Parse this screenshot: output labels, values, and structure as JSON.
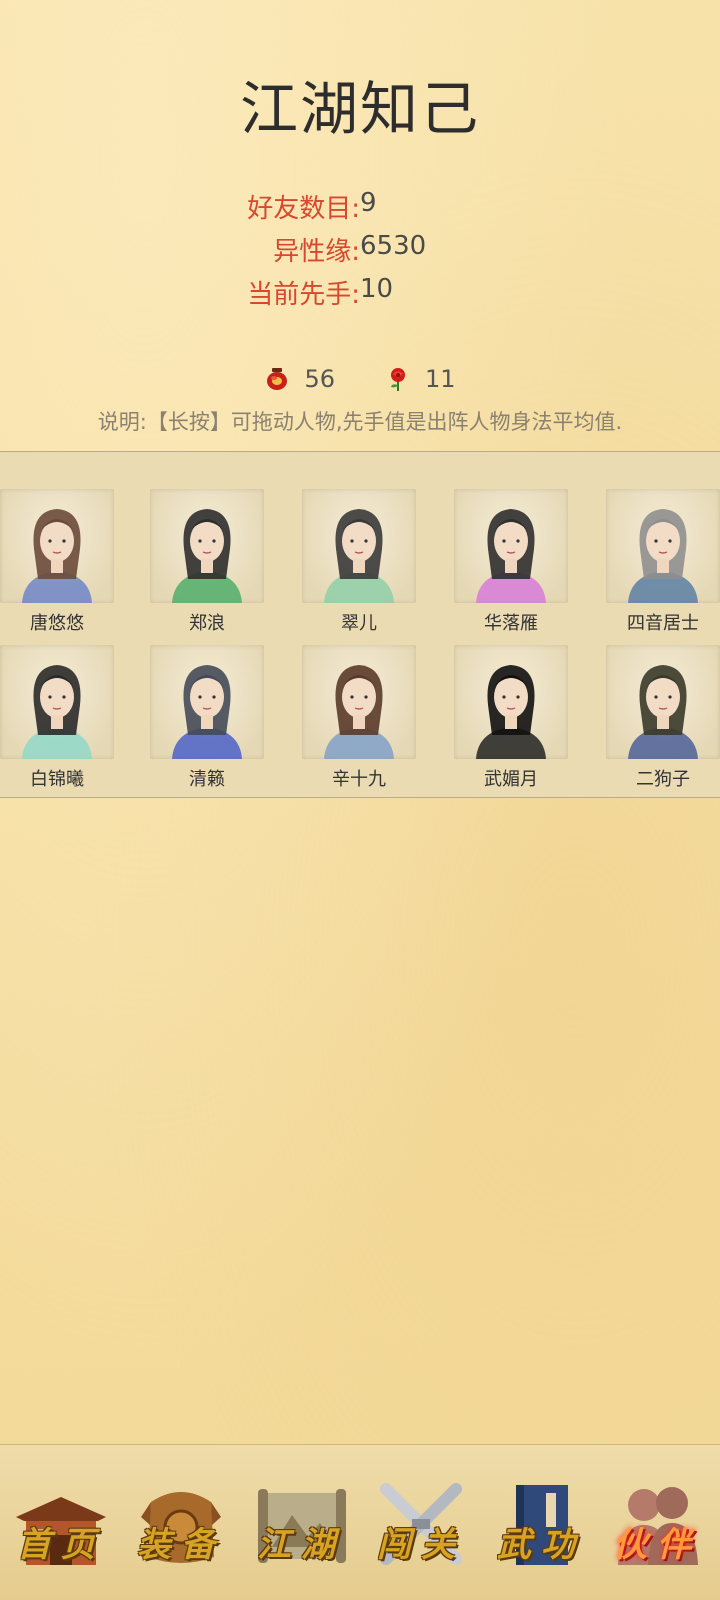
{
  "title": "江湖知己",
  "stats": [
    {
      "label": "好友数目:",
      "value": "9"
    },
    {
      "label": "异性缘:",
      "value": "6530"
    },
    {
      "label": "当前先手:",
      "value": "10"
    }
  ],
  "resources": [
    {
      "icon": "wine-jar-icon",
      "value": "56"
    },
    {
      "icon": "rose-icon",
      "value": "11"
    }
  ],
  "description": "说明:【长按】可拖动人物,先手值是出阵人物身法平均值.",
  "friends": [
    {
      "name": "唐悠悠",
      "hair": "#6b4a3a",
      "robe": "#6f86c8"
    },
    {
      "name": "郑浪",
      "hair": "#2e2e2e",
      "robe": "#4fae6a"
    },
    {
      "name": "翠儿",
      "hair": "#3a3a3a",
      "robe": "#8fcfa8"
    },
    {
      "name": "华落雁",
      "hair": "#2f2f2f",
      "robe": "#d77ad8"
    },
    {
      "name": "四音居士",
      "hair": "#8f8f8f",
      "robe": "#5a7fa5"
    },
    {
      "name": "白锦曦",
      "hair": "#2a2a2a",
      "robe": "#8fd8c8"
    },
    {
      "name": "清籁",
      "hair": "#444a58",
      "robe": "#4b62c8"
    },
    {
      "name": "辛十九",
      "hair": "#5a3a2a",
      "robe": "#7fa0c8"
    },
    {
      "name": "武媚月",
      "hair": "#111111",
      "robe": "#222222"
    },
    {
      "name": "二狗子",
      "hair": "#3a3a2a",
      "robe": "#4c5f9a"
    }
  ],
  "nav": [
    {
      "label": "首页",
      "icon": "house-icon"
    },
    {
      "label": "装备",
      "icon": "armor-icon"
    },
    {
      "label": "江湖",
      "icon": "scroll-map-icon"
    },
    {
      "label": "闯关",
      "icon": "crossed-swords-icon"
    },
    {
      "label": "武功",
      "icon": "martial-book-icon"
    },
    {
      "label": "伙伴",
      "icon": "partners-icon",
      "active": true
    }
  ]
}
